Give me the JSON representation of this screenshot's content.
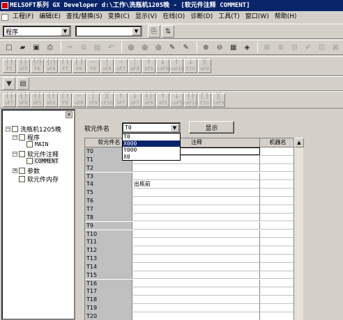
{
  "title_bar": {
    "text": "MELSOFT系列 GX Developer d:\\工作\\洗瓶机1205晚 - [软元件注释 COMMENT]"
  },
  "menu": [
    "工程(F)",
    "编辑(E)",
    "查找/替换(S)",
    "变换(C)",
    "显示(V)",
    "在线(O)",
    "诊断(D)",
    "工具(T)",
    "窗口(W)",
    "帮助(H)"
  ],
  "toolbar_combo": {
    "selected": "程序",
    "second": ""
  },
  "fkeys_row1": [
    "F5",
    "sF5",
    "F6",
    "sF6",
    "F7",
    "F8",
    "F9",
    "sF9",
    "aF7",
    "aF8",
    "aF5",
    "caF5",
    "caF10",
    "F10",
    "aF9"
  ],
  "fkeys_row2": [
    "sF7",
    "sF8",
    "aF1",
    "aF2",
    "F9",
    "sF9",
    "cF9",
    "cF10",
    "sF7",
    "aF7",
    "aF8",
    "aF5",
    "caF5",
    "caF10",
    "F10",
    "caF9"
  ],
  "tree": {
    "root": "洗瓶机1205晚",
    "program": "程序",
    "main": "MAIN",
    "device_comment": "软元件注释",
    "comment": "COMMENT",
    "params": "参数",
    "device_memory": "软元件内存"
  },
  "device_form": {
    "label": "软元件名",
    "value": "T0",
    "display_button": "显示",
    "options": [
      "T0",
      "X000",
      "Y000",
      "X0"
    ],
    "selected_option": "X000"
  },
  "table": {
    "headers": [
      "软元件名",
      "注释",
      "机器名"
    ],
    "rows": [
      {
        "device": "T0",
        "comment": ""
      },
      {
        "device": "T1",
        "comment": ""
      },
      {
        "device": "T2",
        "comment": ""
      },
      {
        "device": "T3",
        "comment": ""
      },
      {
        "device": "T4",
        "comment": "出瓶前"
      },
      {
        "device": "T5",
        "comment": ""
      },
      {
        "device": "T6",
        "comment": ""
      },
      {
        "device": "T7",
        "comment": ""
      },
      {
        "device": "T8",
        "comment": ""
      },
      {
        "device": "T9",
        "comment": ""
      },
      {
        "device": "T10",
        "comment": ""
      },
      {
        "device": "T11",
        "comment": ""
      },
      {
        "device": "T12",
        "comment": ""
      },
      {
        "device": "T13",
        "comment": ""
      },
      {
        "device": "T14",
        "comment": ""
      },
      {
        "device": "T15",
        "comment": ""
      },
      {
        "device": "T16",
        "comment": ""
      },
      {
        "device": "T17",
        "comment": ""
      },
      {
        "device": "T18",
        "comment": ""
      },
      {
        "device": "T19",
        "comment": ""
      },
      {
        "device": "T20",
        "comment": ""
      }
    ]
  }
}
